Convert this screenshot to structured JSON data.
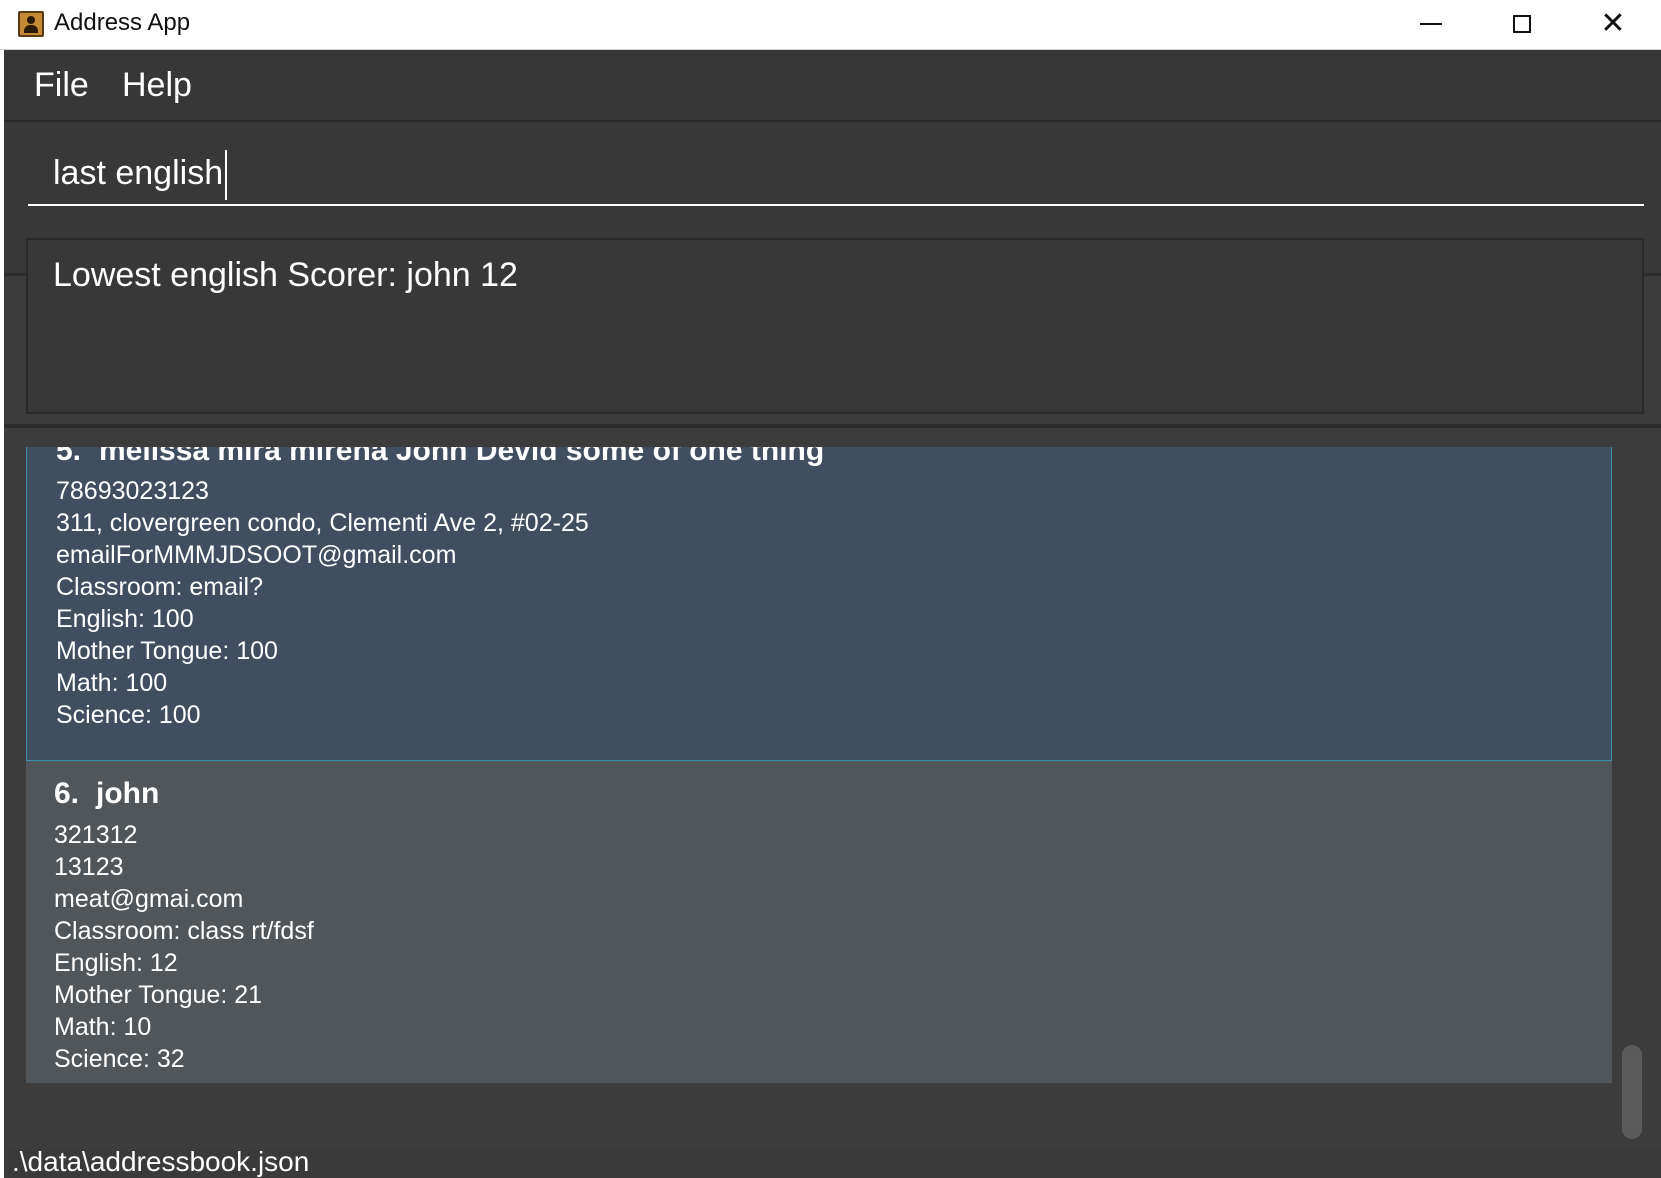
{
  "window": {
    "title": "Address App"
  },
  "menu": {
    "file": "File",
    "help": "Help"
  },
  "command": {
    "value": "last english"
  },
  "result": {
    "message": "Lowest english Scorer: john 12"
  },
  "persons": [
    {
      "index": "5.",
      "name": "melissa mira mirena John Devid some of one thing",
      "phone": "78693023123",
      "address": "311, clovergreen condo, Clementi Ave 2, #02-25",
      "email": "emailForMMMJDSOOT@gmail.com",
      "classroom": "Classroom: email?",
      "english": "English: 100",
      "mother_tongue": "Mother Tongue: 100",
      "math": "Math: 100",
      "science": "Science: 100"
    },
    {
      "index": "6.",
      "name": "john",
      "phone": "321312",
      "address": "13123",
      "email": "meat@gmai.com",
      "classroom": "Classroom: class rt/fdsf",
      "english": "English: 12",
      "mother_tongue": "Mother Tongue: 21",
      "math": "Math: 10",
      "science": "Science: 32"
    }
  ],
  "status": {
    "path": ".\\data\\addressbook.json"
  }
}
